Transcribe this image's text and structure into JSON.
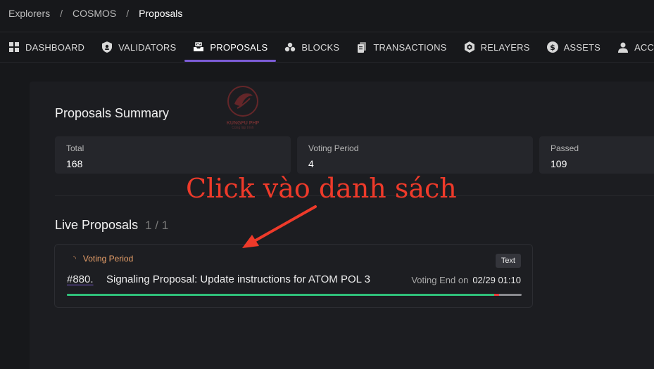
{
  "breadcrumb": {
    "items": [
      "Explorers",
      "COSMOS"
    ],
    "separator": "/",
    "current": "Proposals"
  },
  "nav": {
    "items": [
      {
        "label": "DASHBOARD",
        "icon": "grid-icon"
      },
      {
        "label": "VALIDATORS",
        "icon": "shield-icon"
      },
      {
        "label": "PROPOSALS",
        "icon": "inbox-icon",
        "active": true
      },
      {
        "label": "BLOCKS",
        "icon": "cubes-icon"
      },
      {
        "label": "TRANSACTIONS",
        "icon": "documents-icon"
      },
      {
        "label": "RELAYERS",
        "icon": "hexagon-icon"
      },
      {
        "label": "ASSETS",
        "icon": "dollar-icon"
      },
      {
        "label": "ACC",
        "icon": "user-icon"
      }
    ]
  },
  "summary": {
    "title": "Proposals Summary",
    "cards": [
      {
        "label": "Total",
        "value": "168"
      },
      {
        "label": "Voting Period",
        "value": "4"
      },
      {
        "label": "Passed",
        "value": "109"
      }
    ]
  },
  "live": {
    "title": "Live Proposals",
    "count": "1 / 1",
    "proposal": {
      "status": "Voting Period",
      "type": "Text",
      "id": "#880.",
      "title": "Signaling Proposal: Update instructions for ATOM POL 3",
      "voting_end_label": "Voting End on",
      "voting_end_date": "02/29 01:10",
      "progress": {
        "yes": 0.94,
        "no": 0.01
      }
    }
  },
  "annotation": {
    "text": "Click vào danh sách"
  },
  "watermark": {
    "text": "KUNGFU PHP",
    "sub": "Cùng lập trình"
  },
  "colors": {
    "accent": "#7c5cd6",
    "status_voting": "#e9a06a",
    "progress_yes": "#2fc07a",
    "progress_no": "#e53b3b",
    "annotation": "#ee3a2a"
  }
}
